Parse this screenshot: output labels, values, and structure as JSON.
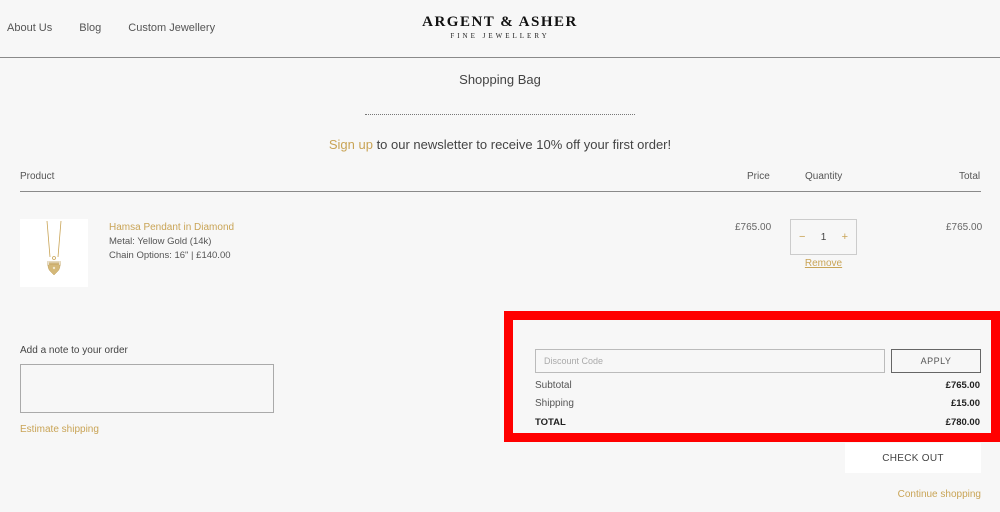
{
  "header": {
    "nav": [
      "About Us",
      "Blog",
      "Custom Jewellery"
    ],
    "logo_main": "ARGENT & ASHER",
    "logo_sub": "FINE JEWELLERY"
  },
  "page": {
    "title": "Shopping Bag",
    "newsletter_link": "Sign up",
    "newsletter_text": " to our newsletter to receive 10% off your first order!"
  },
  "table": {
    "headers": {
      "product": "Product",
      "price": "Price",
      "quantity": "Quantity",
      "total": "Total"
    }
  },
  "item": {
    "name": "Hamsa Pendant in Diamond",
    "metal": "Metal: Yellow Gold (14k)",
    "chain": "Chain Options: 16\" | £140.00",
    "price": "£765.00",
    "quantity": "1",
    "decrement": "−",
    "increment": "+",
    "total": "£765.00",
    "remove": "Remove"
  },
  "note": {
    "label": "Add a note to your order",
    "estimate": "Estimate shipping"
  },
  "summary": {
    "discount_placeholder": "Discount Code",
    "apply": "APPLY",
    "subtotal_label": "Subtotal",
    "subtotal": "£765.00",
    "shipping_label": "Shipping",
    "shipping": "£15.00",
    "total_label": "TOTAL",
    "total": "£780.00"
  },
  "actions": {
    "checkout": "CHECK OUT",
    "continue": "Continue shopping"
  },
  "colors": {
    "accent": "#c9a456",
    "highlight": "#ff0000",
    "background": "#f7f7f7"
  }
}
